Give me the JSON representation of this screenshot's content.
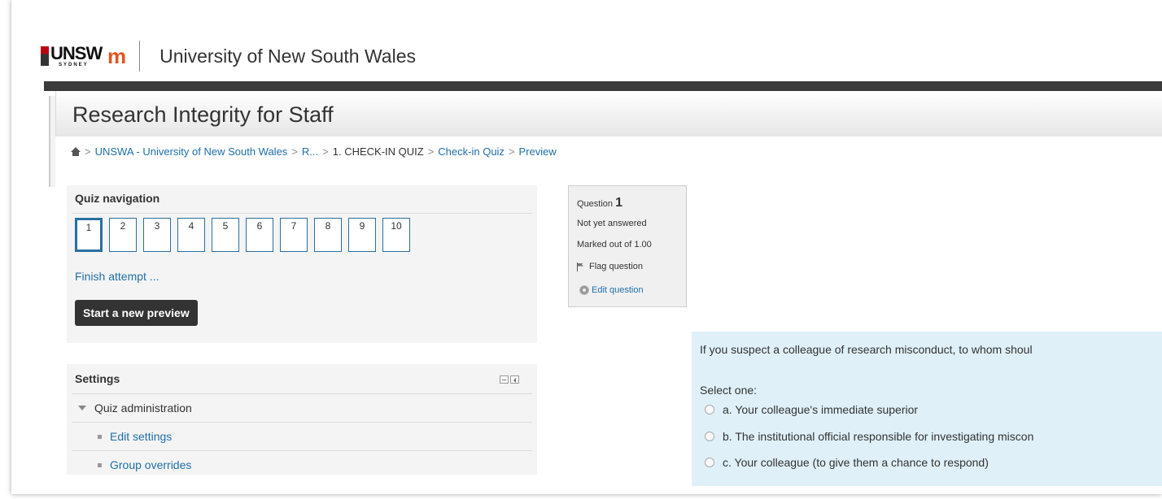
{
  "header": {
    "logo_unsw": "UNSW",
    "logo_unsw_sub": "SYDNEY",
    "logo_moodle": "m",
    "site_name": "University of New South Wales"
  },
  "page": {
    "title": "Research Integrity for Staff"
  },
  "breadcrumb": {
    "items": [
      "UNSWA - University of New South Wales",
      "R...",
      "1. CHECK-IN QUIZ",
      "Check-in Quiz",
      "Preview"
    ]
  },
  "quiz_navigation": {
    "title": "Quiz navigation",
    "questions": [
      "1",
      "2",
      "3",
      "4",
      "5",
      "6",
      "7",
      "8",
      "9",
      "10"
    ],
    "finish_label": "Finish attempt ...",
    "start_label": "Start a new preview"
  },
  "settings": {
    "title": "Settings",
    "admin_label": "Quiz administration",
    "items": [
      "Edit settings",
      "Group overrides"
    ]
  },
  "question_info": {
    "label": "Question",
    "number": "1",
    "state": "Not yet answered",
    "grade": "Marked out of 1.00",
    "flag_label": "Flag question",
    "edit_label": "Edit question"
  },
  "question": {
    "text": "If you suspect a colleague of research misconduct, to whom shoul",
    "prompt": "Select one:",
    "answers": [
      "a. Your colleague's immediate superior",
      "b. The institutional official responsible for investigating miscon",
      "c. Your colleague (to give them a chance to respond)"
    ]
  }
}
